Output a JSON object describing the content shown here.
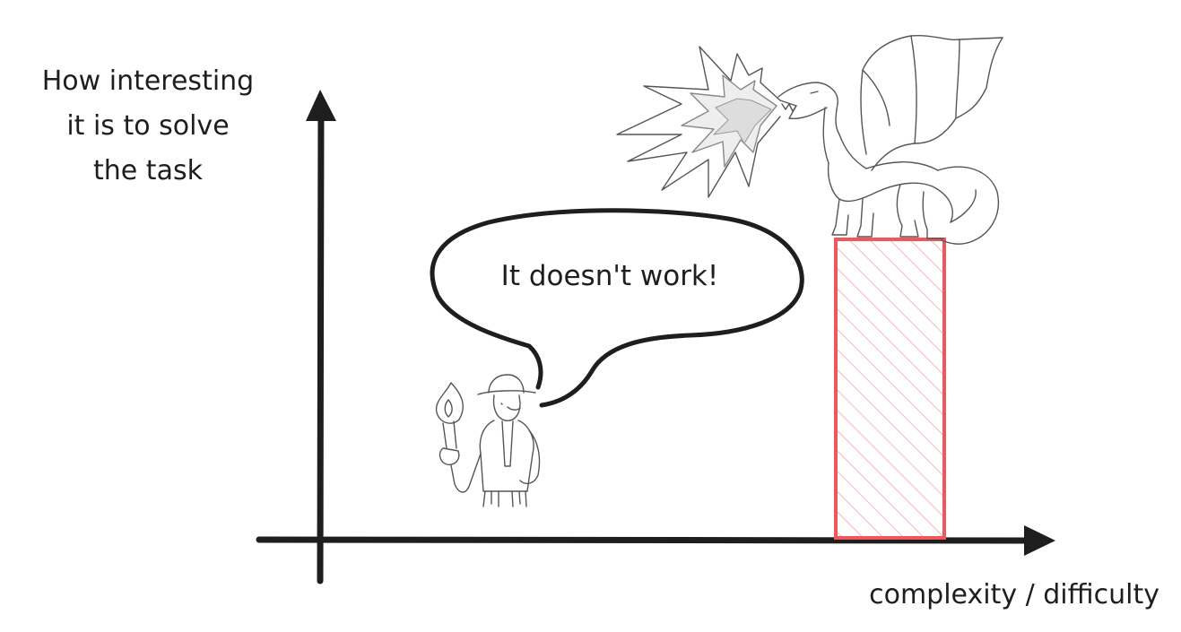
{
  "y_axis_label": [
    "How interesting",
    "it is to solve",
    "the task"
  ],
  "x_axis_label": "complexity / difficulty",
  "speech_bubble_text": "It doesn't work!",
  "colors": {
    "ink": "#1e1e1e",
    "bar_stroke": "#f0575d",
    "bar_hatch": "#f7b7ba",
    "sketch_gray": "#555555"
  },
  "icons": {
    "adventurer": "explorer-with-torch-icon",
    "dragon": "fire-breathing-dragon-icon"
  }
}
